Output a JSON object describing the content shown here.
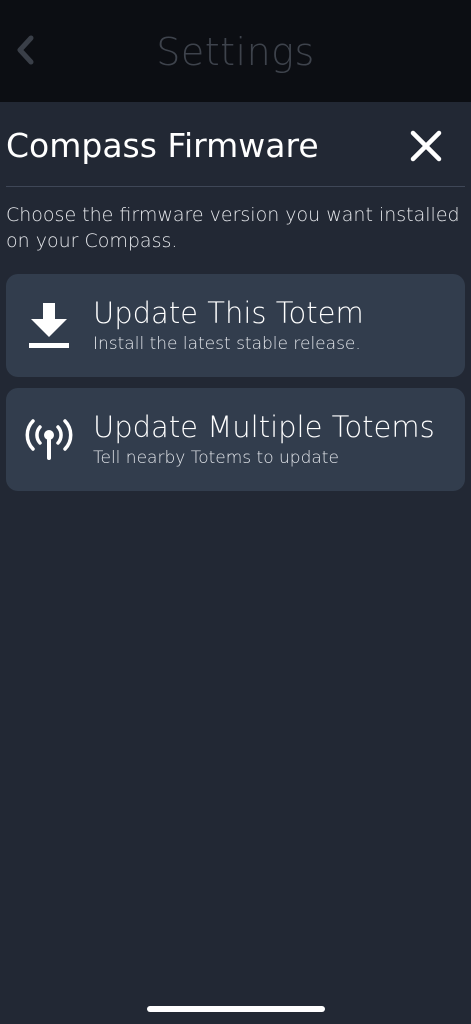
{
  "top_bar": {
    "title": "Settings",
    "back_icon": "chevron-left-icon"
  },
  "modal": {
    "title": "Compass Firmware",
    "close_icon": "close-icon",
    "description": "Choose the firmware version you want installed on your Compass."
  },
  "options": [
    {
      "icon": "download-icon",
      "title": "Update This Totem",
      "subtitle": "Install the latest stable release."
    },
    {
      "icon": "broadcast-antenna-icon",
      "title": "Update Multiple Totems",
      "subtitle": "Tell nearby Totems to update"
    }
  ],
  "colors": {
    "background": "#222834",
    "top_bar": "#0c0e13",
    "card": "#323d4d",
    "muted_title": "#3e434c"
  }
}
